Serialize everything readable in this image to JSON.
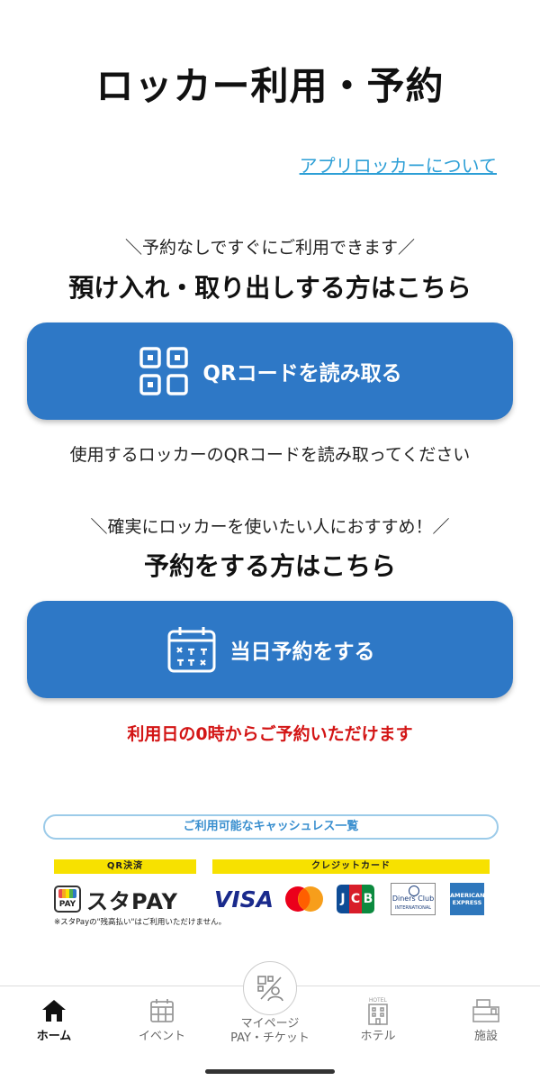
{
  "header": {
    "title": "ロッカー利用・予約",
    "about_link": "アプリロッカーについて"
  },
  "section_checkin": {
    "subtitle": "＼予約なしですぐにご利用できます／",
    "heading": "預け入れ・取り出しする方はこちら",
    "button_label": "QRコードを読み取る",
    "button_icon": "qr-code-icon",
    "caption": "使用するロッカーのQRコードを読み取ってください"
  },
  "section_reserve": {
    "subtitle": "＼確実にロッカーを使いたい人におすすめ！／",
    "heading": "予約をする方はこちら",
    "button_label": "当日予約をする",
    "button_icon": "calendar-icon",
    "caption": "利用日の0時からご予約いただけます"
  },
  "payment": {
    "header": "ご利用可能なキャッシュレス一覧",
    "qr_label": "QR決済",
    "card_label": "クレジットカード",
    "stapay_name": "スタPAY",
    "stapay_logo_text": "PAY",
    "stapay_note": "※スタPayの\"残高払い\"はご利用いただけません。",
    "cards": [
      "VISA",
      "Mastercard",
      "JCB",
      "Diners Club",
      "American Express"
    ],
    "visa_text": "VISA",
    "jcb_letters": [
      "J",
      "C",
      "B"
    ],
    "diners_text": "Diners Club",
    "diners_sub": "INTERNATIONAL",
    "amex_text": "AMERICAN EXPRESS"
  },
  "colors": {
    "primary_button": "#2e78c6",
    "link": "#2d9fd6",
    "alert_text": "#d31515",
    "label_bg": "#f7e100"
  },
  "tabbar": {
    "tabs": [
      {
        "label": "ホーム",
        "icon": "home-icon",
        "active": true
      },
      {
        "label": "イベント",
        "icon": "event-calendar-icon",
        "active": false
      },
      {
        "label": "マイページ\nPAY・チケット",
        "line1": "マイページ",
        "line2": "PAY・チケット",
        "icon": "mypage-qr-user-icon",
        "active": false
      },
      {
        "label": "ホテル",
        "icon": "hotel-icon",
        "active": false
      },
      {
        "label": "施設",
        "icon": "facility-icon",
        "active": false
      }
    ],
    "hotel_icon_text": "HOTEL"
  }
}
